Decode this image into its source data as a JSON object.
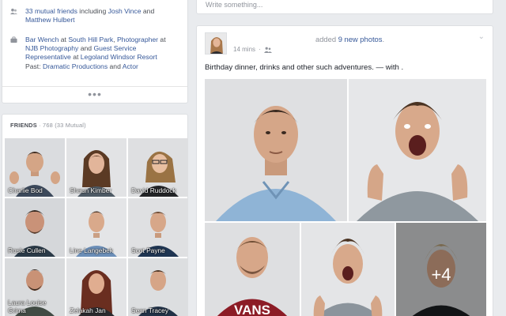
{
  "intro": {
    "mutual_friends": {
      "count_text": "33 mutual friends",
      "joiner": " including ",
      "friend1": "Josh Vince",
      "and": " and ",
      "friend2": "Matthew Hulbert"
    },
    "work": {
      "role1": "Bar Wench",
      "at1": " at ",
      "place1": "South Hill Park",
      "sep1": ", ",
      "role2": "Photographer",
      "at2": " at ",
      "place2": "NJB Photography",
      "and": " and ",
      "role3": "Guest Service Representative",
      "at3": " at ",
      "place3": "Legoland Windsor Resort",
      "past_label": "Past: ",
      "past1": "Dramatic Productions",
      "past_and": " and ",
      "past2": "Actor"
    },
    "see_more": "•••"
  },
  "friends": {
    "heading": "FRIENDS",
    "count": " · 768 (33 Mutual)",
    "list": [
      {
        "name": "Charlie Bod"
      },
      {
        "name": "Shaun Kimber"
      },
      {
        "name": "David Ruddock"
      },
      {
        "name": "Rosie Cullen"
      },
      {
        "name": "Line Langebek"
      },
      {
        "name": "Scot Payne"
      },
      {
        "name": "Laura Louise Grima"
      },
      {
        "name": "Zelakah Jan"
      },
      {
        "name": "Sean Tracey"
      }
    ]
  },
  "composer": {
    "placeholder": "Write something..."
  },
  "post": {
    "action_prefix": "added ",
    "action_link": "9 new photos",
    "action_suffix": ".",
    "time": "14 mins",
    "dot": "·",
    "text": "Birthday dinner, drinks and other such adventures. — with ."
  },
  "photos": {
    "more_count": "+4"
  },
  "colors": {
    "link": "#365899",
    "muted": "#90949c",
    "background": "#e9ebee"
  }
}
